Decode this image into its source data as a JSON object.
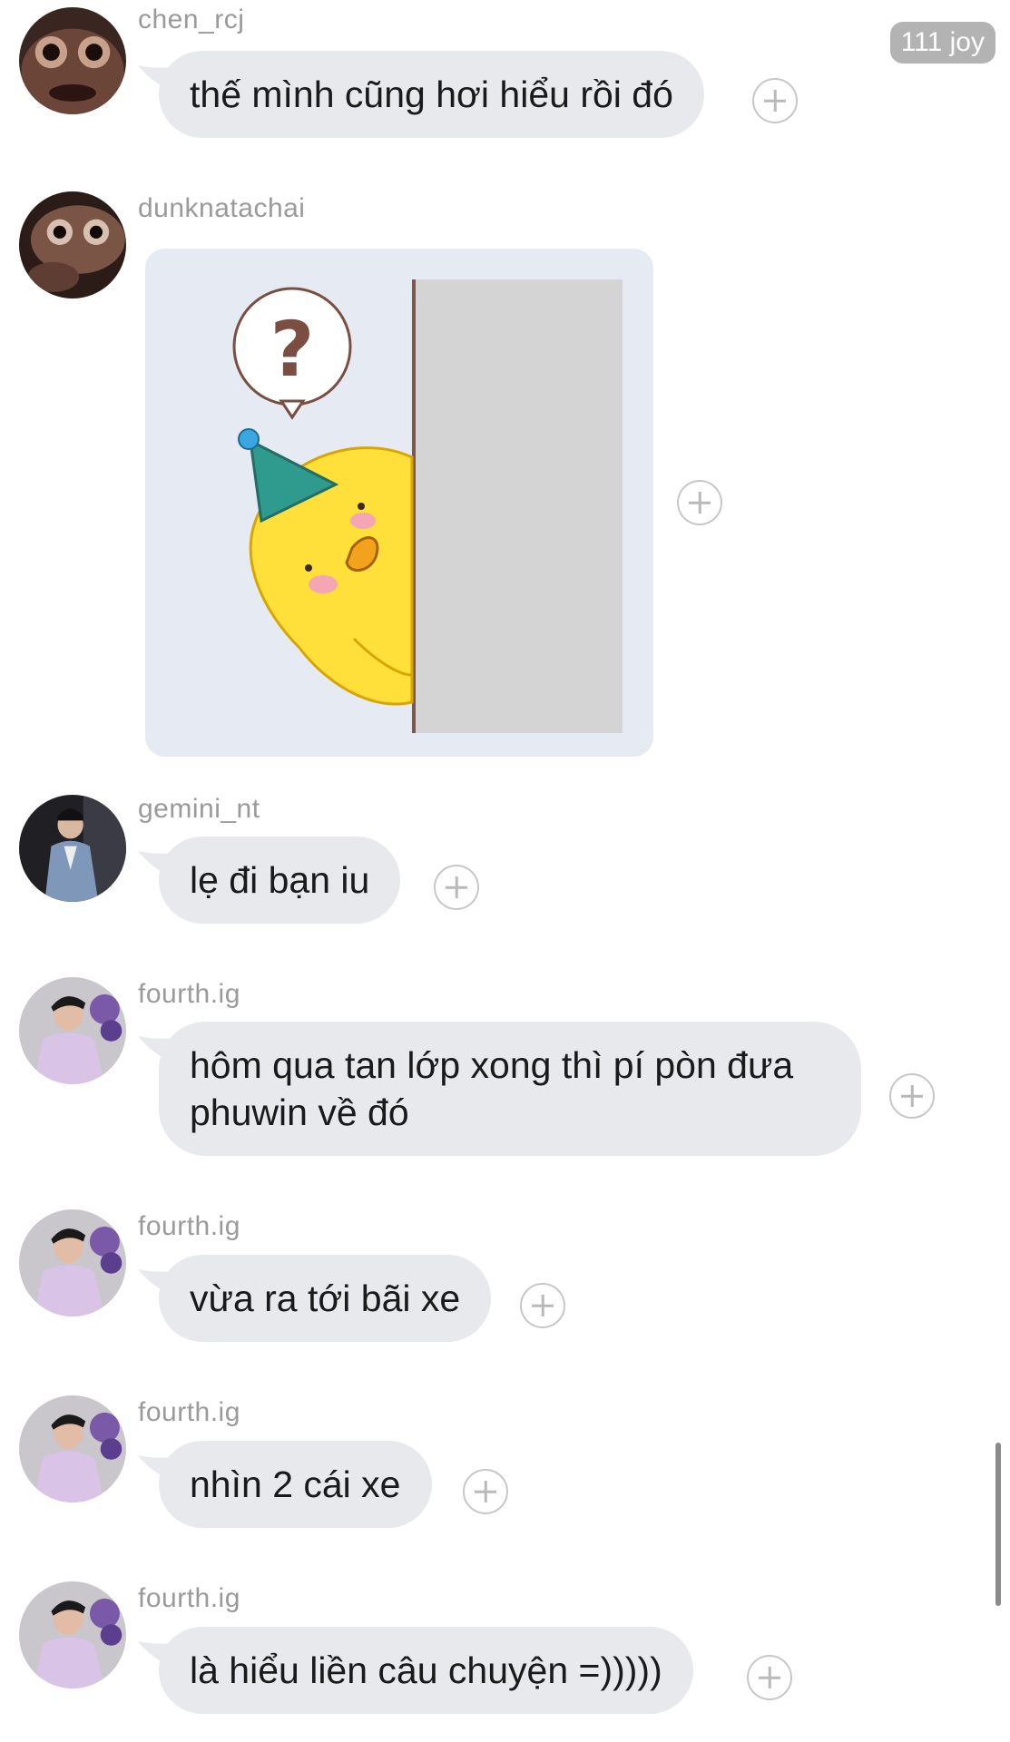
{
  "badge": {
    "text": "111 joy"
  },
  "messages": [
    {
      "username": "chen_rcj",
      "text": "thế mình cũng hơi hiểu rồi đó"
    },
    {
      "username": "dunknatachai",
      "sticker": "duck-peeking-question-sticker"
    },
    {
      "username": "gemini_nt",
      "text": "lẹ đi bạn iu"
    },
    {
      "username": "fourth.ig",
      "text": "hôm qua tan lớp xong thì pí pòn đưa phuwin về đó"
    },
    {
      "username": "fourth.ig",
      "text": "vừa ra tới bãi xe"
    },
    {
      "username": "fourth.ig",
      "text": "nhìn 2 cái xe"
    },
    {
      "username": "fourth.ig",
      "text": "là hiểu liền câu chuyện =)))))"
    }
  ],
  "colors": {
    "bubble": "#e7e9ed",
    "username": "#9a9a9a",
    "badge": "#b3b3b3",
    "sticker_bg": "#e6eaf3"
  }
}
